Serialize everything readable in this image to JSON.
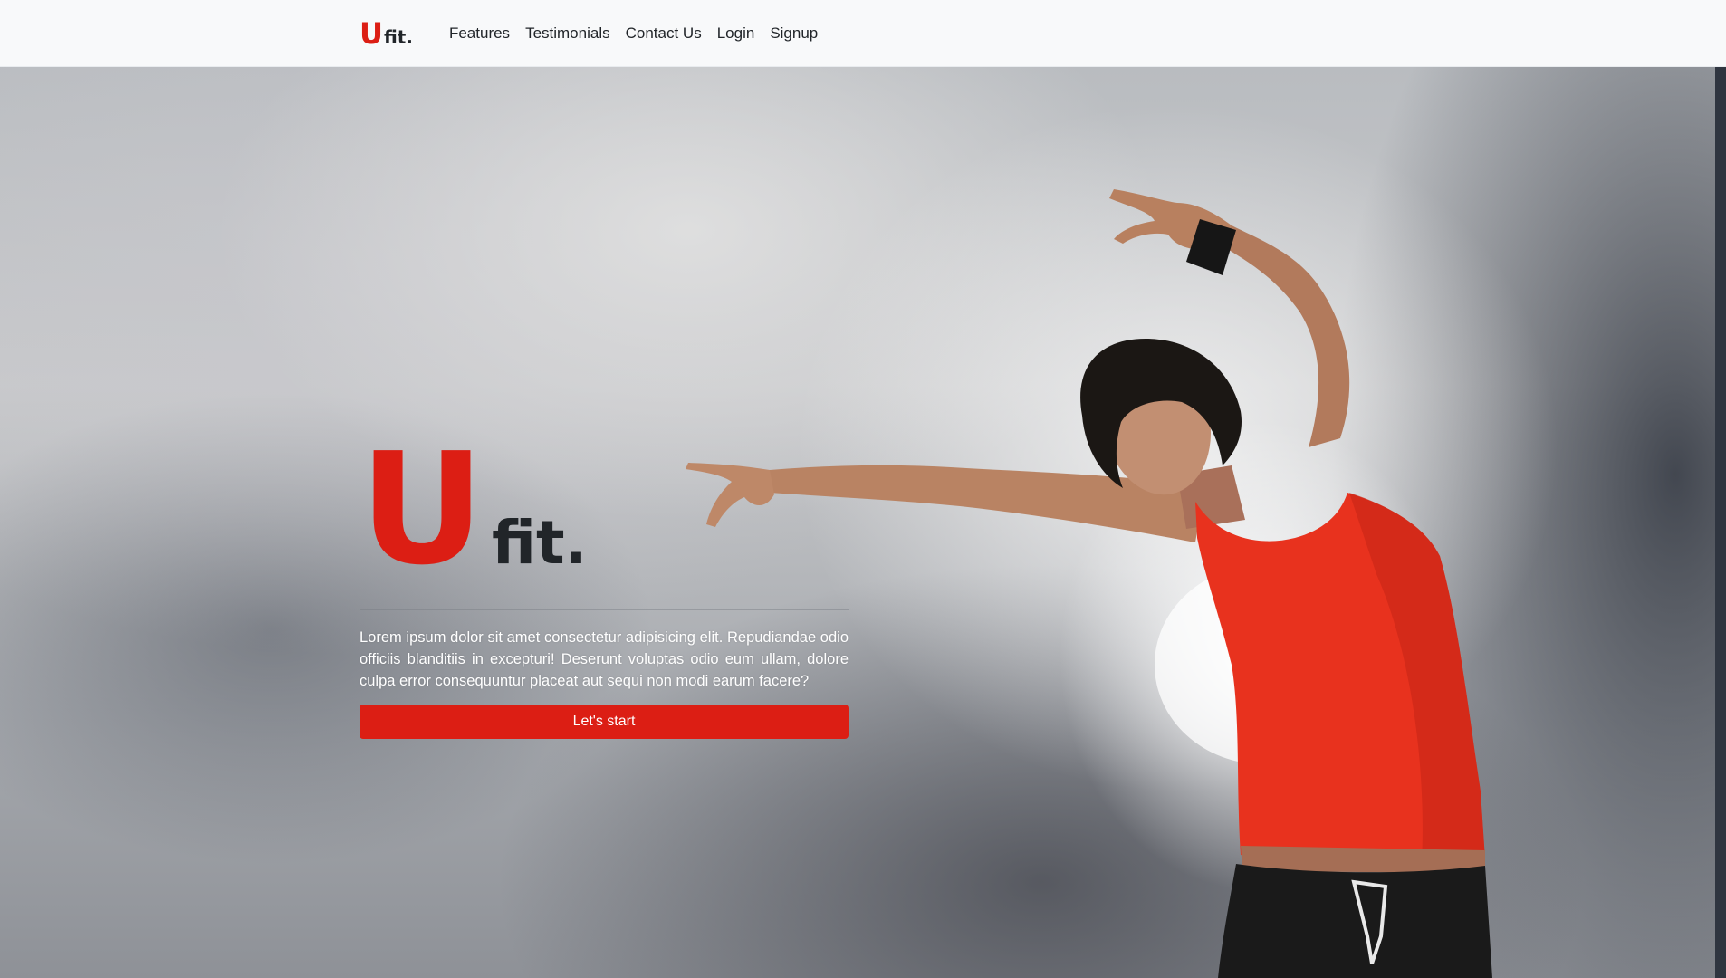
{
  "navbar": {
    "brand_u": "U",
    "brand_fit": "fit.",
    "links": [
      "Features",
      "Testimonials",
      "Contact Us",
      "Login",
      "Signup"
    ]
  },
  "hero": {
    "logo_u": "U",
    "logo_fit": "fit.",
    "description": "Lorem ipsum dolor sit amet consectetur adipisicing elit. Repudiandae odio officiis blanditiis in excepturi! Deserunt voluptas odio eum ullam, dolore culpa error consequuntur placeat aut sequi non modi earum facere?",
    "button_label": "Let's start",
    "background_image": "woman-stretching-sky-photo"
  },
  "colors": {
    "accent": "#dc1e14",
    "dark_text": "#212529",
    "navbar_bg": "#f8f9fa"
  }
}
